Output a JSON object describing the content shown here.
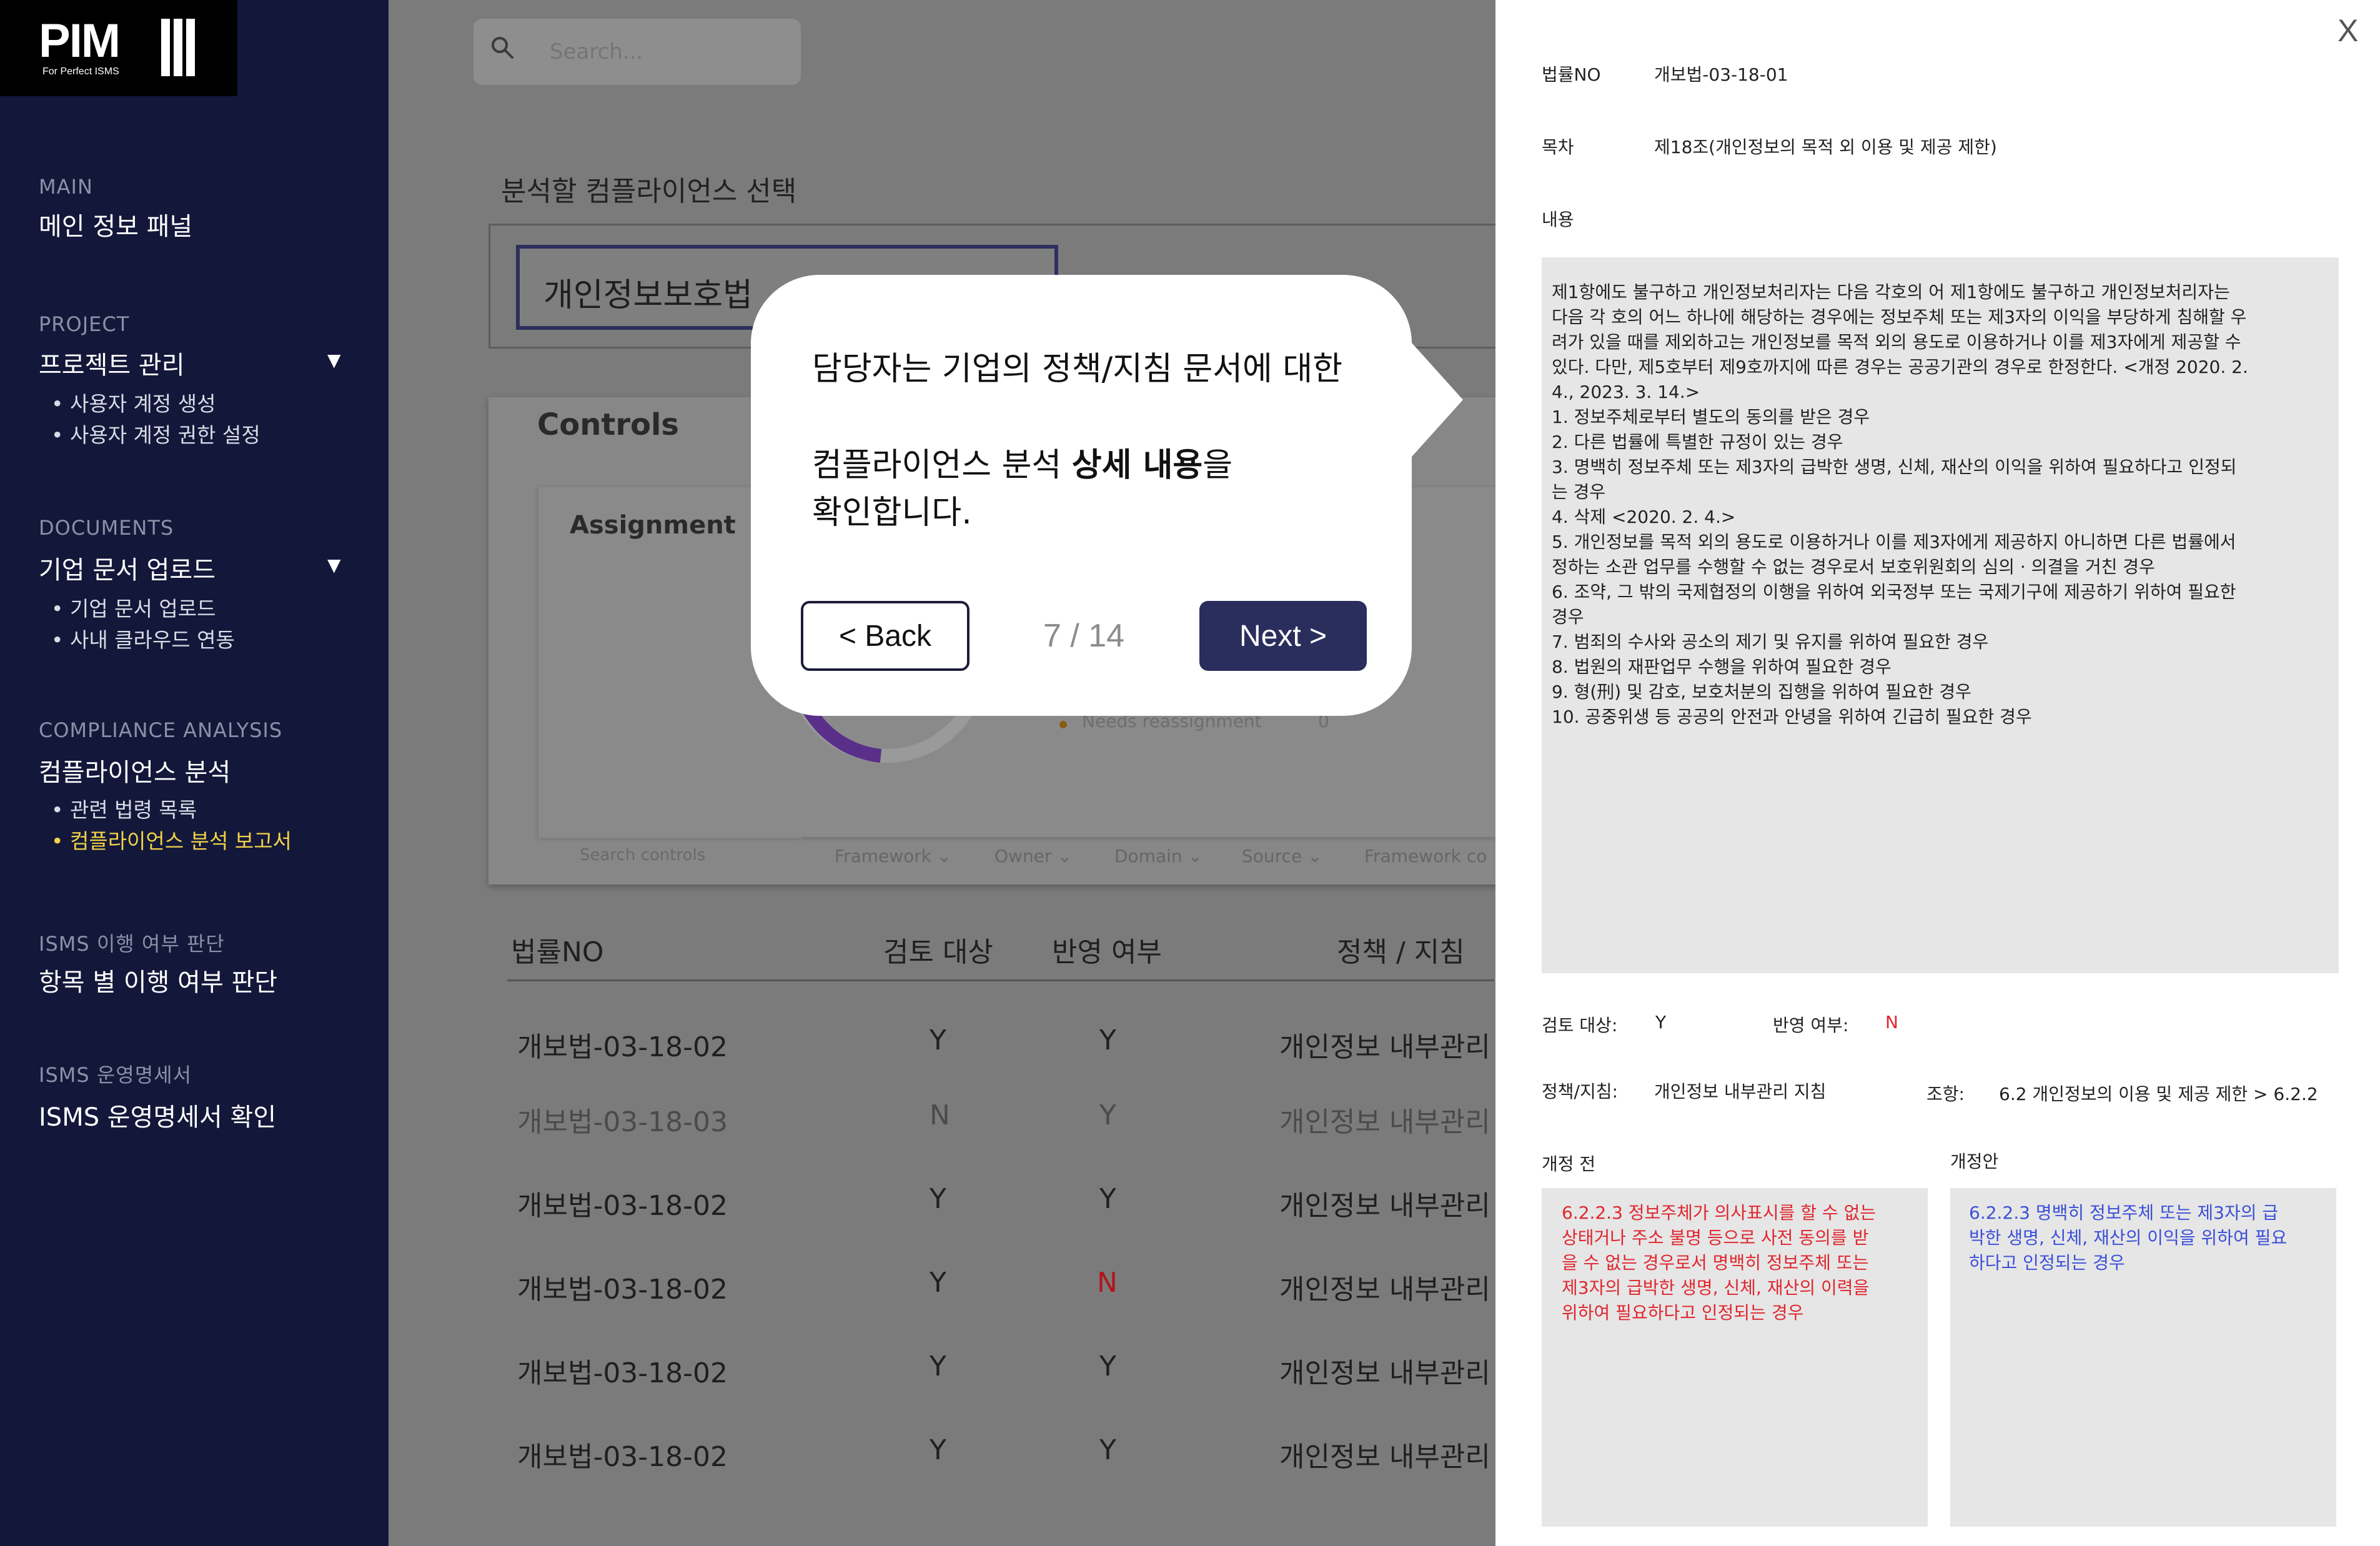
{
  "sidebar": {
    "logo": "PIM",
    "logo_sub": "For Perfect ISMS",
    "sections": [
      {
        "label": "MAIN",
        "title": "메인 정보 패널"
      },
      {
        "label": "PROJECT",
        "title": "프로젝트 관리",
        "items": [
          "사용자 계정 생성",
          "사용자 계정 권한 설정"
        ]
      },
      {
        "label": "DOCUMENTS",
        "title": "기업 문서 업로드",
        "items": [
          "기업 문서 업로드",
          "사내 클라우드 연동"
        ]
      },
      {
        "label": "COMPLIANCE ANALYSIS",
        "title": "컴플라이언스 분석",
        "items": [
          "관련 법령 목록",
          "컴플라이언스 분석 보고서"
        ]
      },
      {
        "label": "ISMS 이행 여부 판단",
        "title": "항목 별 이행 여부 판단"
      },
      {
        "label": "ISMS 운영명세서",
        "title": "ISMS 운영명세서 확인"
      }
    ],
    "active_color": "#f2d24a",
    "background": "#13183a"
  },
  "main": {
    "search_placeholder": "Search...",
    "select_label": "분석할 컴플라이언스 선택",
    "select_value": "개인정보보호법",
    "controls_title": "Controls",
    "assignment_title": "Assignment",
    "legend_item": "Needs reassignment",
    "legend_value": "0",
    "filter_search_placeholder": "Search controls",
    "filters": [
      "Framework ⌄",
      "Owner ⌄",
      "Domain ⌄",
      "Source ⌄",
      "Framework co"
    ],
    "table": {
      "headers": [
        "법률NO",
        "검토 대상",
        "반영 여부",
        "정책 / 지침"
      ],
      "rows": [
        [
          "개보법-03-18-02",
          "Y",
          "Y",
          "개인정보 내부관리"
        ],
        [
          "개보법-03-18-03",
          "N",
          "Y",
          "개인정보 내부관리"
        ],
        [
          "개보법-03-18-02",
          "Y",
          "Y",
          "개인정보 내부관리"
        ],
        [
          "개보법-03-18-02",
          "Y",
          "N",
          "개인정보 내부관리"
        ],
        [
          "개보법-03-18-02",
          "Y",
          "Y",
          "개인정보 내부관리"
        ],
        [
          "개보법-03-18-02",
          "Y",
          "Y",
          "개인정보 내부관리"
        ]
      ]
    }
  },
  "tooltip": {
    "line1": "담당자는 기업의 정책/지침 문서에 대한",
    "line2_prefix": "컴플라이언스 분석 ",
    "line2_bold": "상세 내용",
    "line2_suffix": "을",
    "line3": "확인합니다.",
    "back_label": "< Back",
    "step": "7 / 14",
    "next_label": "Next >",
    "next_color": "#2a2e5c"
  },
  "detail": {
    "close": "X",
    "law_no_label": "법률NO",
    "law_no": "개보법-03-18-01",
    "toc_label": "목차",
    "toc": "제18조(개인정보의 목적 외 이용 및 제공 제한)",
    "content_label": "내용",
    "content": "제1항에도 불구하고 개인정보처리자는 다음 각호의 어 제1항에도 불구하고 개인정보처리자는\n다음 각 호의 어느 하나에 해당하는 경우에는 정보주체 또는 제3자의 이익을 부당하게 침해할 우\n려가 있을 때를 제외하고는 개인정보를 목적 외의 용도로 이용하거나 이를 제3자에게 제공할 수\n있다. 다만, 제5호부터 제9호까지에 따른 경우는 공공기관의 경우로 한정한다. <개정 2020. 2.\n4., 2023. 3. 14.>\n1. 정보주체로부터 별도의 동의를 받은 경우\n2. 다른 법률에 특별한 규정이 있는 경우\n3. 명백히 정보주체 또는 제3자의 급박한 생명, 신체, 재산의 이익을 위하여 필요하다고 인정되\n는 경우\n4. 삭제 <2020. 2. 4.>\n5. 개인정보를 목적 외의 용도로 이용하거나 이를 제3자에게 제공하지 아니하면 다른 법률에서\n정하는 소관 업무를 수행할 수 없는 경우로서 보호위원회의 심의 · 의결을 거친 경우\n6. 조약, 그 밖의 국제협정의 이행을 위하여 외국정부 또는 국제기구에 제공하기 위하여 필요한\n경우\n7. 범죄의 수사와 공소의 제기 및 유지를 위하여 필요한 경우\n8. 법원의 재판업무 수행을 위하여 필요한 경우\n9. 형(刑) 및 감호, 보호처분의 집행을 위하여 필요한 경우\n10. 공중위생 등 공공의 안전과 안녕을 위하여 긴급히 필요한 경우",
    "review_label": "검토 대상:",
    "review_value": "Y",
    "reflect_label": "반영 여부:",
    "reflect_value": "N",
    "policy_label": "정책/지침:",
    "policy_value": "개인정보 내부관리 지침",
    "clause_label": "조항:",
    "clause_value": "6.2 개인정보의 이용 및 제공 제한 > 6.2.2",
    "before_label": "개정 전",
    "after_label": "개정안",
    "before_text": "6.2.2.3 정보주체가 의사표시를 할 수 없는\n상태거나 주소 불명 등으로 사전 동의를 받\n을 수 없는 경우로서 명백히 정보주체 또는\n제3자의 급박한 생명, 신체, 재산의 이력을\n위하여 필요하다고 인정되는 경우",
    "after_text": "6.2.2.3 명백히 정보주체 또는 제3자의 급\n박한 생명, 신체, 재산의 이익을 위하여 필요\n하다고 인정되는 경우",
    "before_color": "#e0262e",
    "after_color": "#3b4fd8",
    "reflect_color": "#e0262e"
  }
}
